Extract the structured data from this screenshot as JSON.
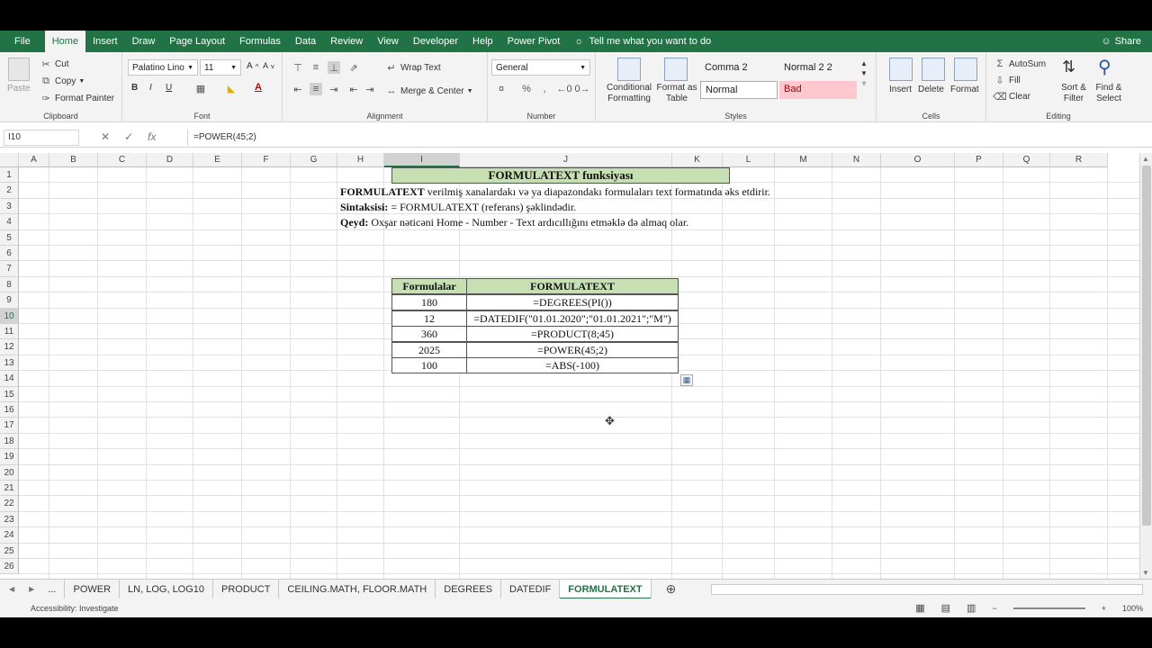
{
  "ribbon_tabs": [
    "File",
    "Home",
    "Insert",
    "Draw",
    "Page Layout",
    "Formulas",
    "Data",
    "Review",
    "View",
    "Developer",
    "Help",
    "Power Pivot"
  ],
  "tell_me": "Tell me what you want to do",
  "share": "Share",
  "clipboard": {
    "paste": "Paste",
    "cut": "Cut",
    "copy": "Copy",
    "format_painter": "Format Painter",
    "label": "Clipboard"
  },
  "font": {
    "name": "Palatino Lino",
    "size": "11",
    "label": "Font"
  },
  "alignment": {
    "wrap": "Wrap Text",
    "merge": "Merge & Center",
    "label": "Alignment"
  },
  "number": {
    "format": "General",
    "label": "Number"
  },
  "styles": {
    "cond": "Conditional Formatting",
    "fmt_table": "Format as Table",
    "comma2": "Comma 2",
    "normal22": "Normal 2 2",
    "normal": "Normal",
    "bad": "Bad",
    "label": "Styles"
  },
  "cells": {
    "insert": "Insert",
    "delete": "Delete",
    "format": "Format",
    "label": "Cells"
  },
  "editing": {
    "autosum": "AutoSum",
    "fill": "Fill",
    "clear": "Clear",
    "sort": "Sort & Filter",
    "find": "Find & Select",
    "label": "Editing"
  },
  "name_box": "I10",
  "formula_bar": "=POWER(45;2)",
  "columns": [
    "A",
    "B",
    "C",
    "D",
    "E",
    "F",
    "G",
    "H",
    "I",
    "J",
    "K",
    "L",
    "M",
    "N",
    "O",
    "P",
    "Q",
    "R"
  ],
  "rows": [
    "1",
    "2",
    "3",
    "4",
    "5",
    "6",
    "7",
    "8",
    "9",
    "10",
    "11",
    "12",
    "13",
    "14",
    "15",
    "16",
    "17",
    "18",
    "19",
    "20",
    "21",
    "22",
    "23",
    "24",
    "25",
    "26"
  ],
  "sheet": {
    "title": "FORMULATEXT funksiyası",
    "line2_bold": "FORMULATEXT",
    "line2": " verilmiş xanalardakı və ya diapazondakı formulaları text formatında əks etdirir.",
    "line3_bold": "Sintaksisi:",
    "line3": " = FORMULATEXT (referans) şəklindədir.",
    "line4_bold": "Qeyd:",
    "line4": " Oxşar nəticəni Home - Number - Text ardıcıllığını etməklə də almaq olar.",
    "table_headers": [
      "Formulalar",
      "FORMULATEXT"
    ],
    "table_rows": [
      [
        "180",
        "=DEGREES(PI())"
      ],
      [
        "12",
        "=DATEDIF(\"01.01.2020\";\"01.01.2021\";\"M\")"
      ],
      [
        "360",
        "=PRODUCT(8;45)"
      ],
      [
        "2025",
        "=POWER(45;2)"
      ],
      [
        "100",
        "=ABS(-100)"
      ]
    ]
  },
  "sheet_tabs": [
    "...",
    "POWER",
    "LN, LOG, LOG10",
    "PRODUCT",
    "CEILING.MATH, FLOOR.MATH",
    "DEGREES",
    "DATEDIF",
    "FORMULATEXT"
  ],
  "status": {
    "accessibility": "Accessibility: Investigate",
    "zoom": "100%"
  }
}
